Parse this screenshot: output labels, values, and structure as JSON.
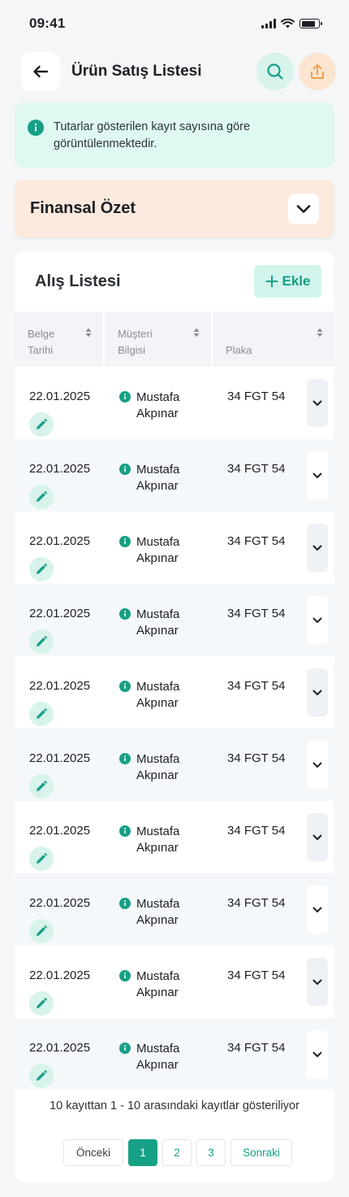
{
  "status_bar": {
    "time": "09:41"
  },
  "header": {
    "title": "Ürün Satış Listesi"
  },
  "info_banner": {
    "text": "Tutarlar gösterilen kayıt sayısına göre görüntülenmektedir."
  },
  "summary": {
    "title": "Finansal Özet"
  },
  "list": {
    "title": "Alış Listesi",
    "add_label": "Ekle",
    "columns": {
      "date": [
        "Belge",
        "Tarihi"
      ],
      "customer": [
        "Müşteri",
        "Bilgisi"
      ],
      "plate": "Plaka"
    },
    "rows": [
      {
        "date": "22.01.2025",
        "customer": [
          "Mustafa",
          "Akpınar"
        ],
        "plate": "34 FGT 54"
      },
      {
        "date": "22.01.2025",
        "customer": [
          "Mustafa",
          "Akpınar"
        ],
        "plate": "34 FGT 54"
      },
      {
        "date": "22.01.2025",
        "customer": [
          "Mustafa",
          "Akpınar"
        ],
        "plate": "34 FGT 54"
      },
      {
        "date": "22.01.2025",
        "customer": [
          "Mustafa",
          "Akpınar"
        ],
        "plate": "34 FGT 54"
      },
      {
        "date": "22.01.2025",
        "customer": [
          "Mustafa",
          "Akpınar"
        ],
        "plate": "34 FGT 54"
      },
      {
        "date": "22.01.2025",
        "customer": [
          "Mustafa",
          "Akpınar"
        ],
        "plate": "34 FGT 54"
      },
      {
        "date": "22.01.2025",
        "customer": [
          "Mustafa",
          "Akpınar"
        ],
        "plate": "34 FGT 54"
      },
      {
        "date": "22.01.2025",
        "customer": [
          "Mustafa",
          "Akpınar"
        ],
        "plate": "34 FGT 54"
      },
      {
        "date": "22.01.2025",
        "customer": [
          "Mustafa",
          "Akpınar"
        ],
        "plate": "34 FGT 54"
      },
      {
        "date": "22.01.2025",
        "customer": [
          "Mustafa",
          "Akpınar"
        ],
        "plate": "34 FGT 54"
      }
    ],
    "footer_text": "10 kayıttan 1 - 10 arasındaki kayıtlar gösteriliyor"
  },
  "pagination": {
    "prev_label": "Önceki",
    "pages": [
      "1",
      "2",
      "3"
    ],
    "active_page": "1",
    "next_label": "Sonraki"
  },
  "colors": {
    "accent": "#16a085",
    "accent_light": "#d7f3ec",
    "summary_bg": "#fbeadd",
    "upload_accent": "#f0a24b"
  },
  "icons": {
    "back": "arrow-left-icon",
    "search": "search-icon",
    "upload": "upload-icon",
    "info": "info-icon",
    "toggle": "chevron-down-icon",
    "add": "plus-icon",
    "sort": "sort-icon",
    "edit": "pencil-icon",
    "expand": "chevron-down-icon"
  }
}
